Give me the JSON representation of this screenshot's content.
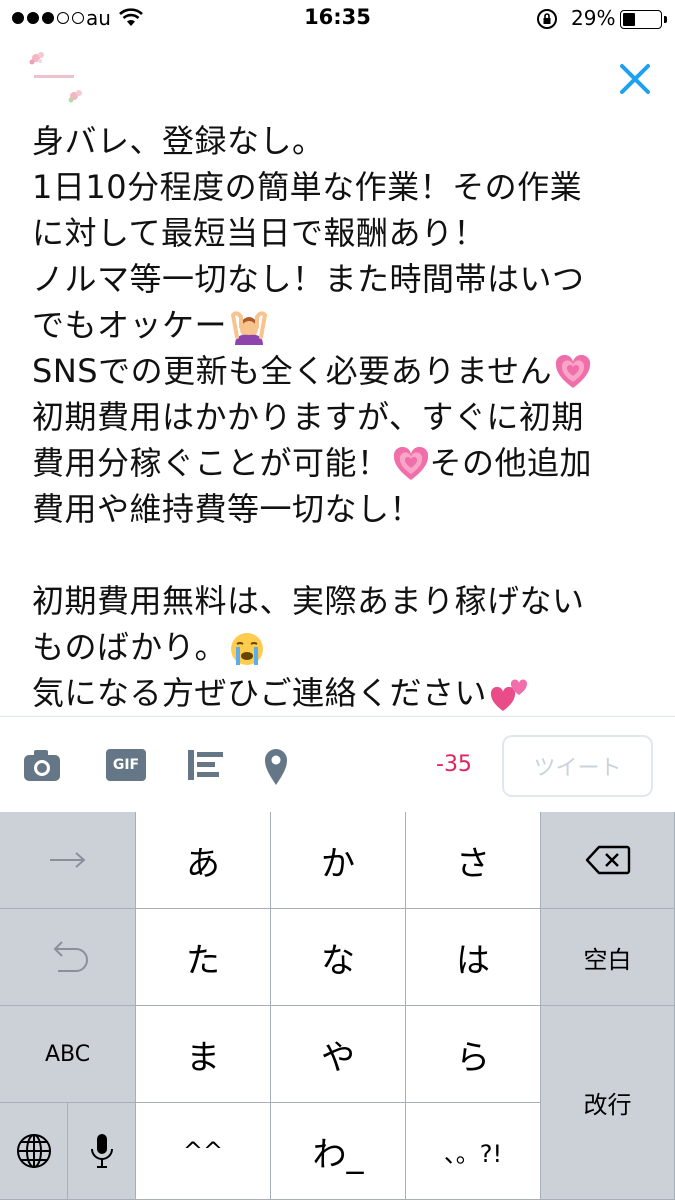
{
  "status_bar": {
    "carrier": "au",
    "time": "16:35",
    "battery_percent_text": "29%",
    "battery_level": 0.29,
    "signal_bars_filled": 3,
    "signal_bars_total": 5
  },
  "compose": {
    "lines": [
      "身バレ、登録なし。",
      "1日10分程度の簡単な作業！その作業",
      "に対して最短当日で報酬あり！",
      "ノルマ等一切なし！また時間帯はいつ",
      "でもオッケー",
      "SNSでの更新も全く必要ありません",
      "初期費用はかかりますが、すぐに初期",
      "費用分稼ぐことが可能！",
      "その他追加",
      "費用や維持費等一切なし！",
      "",
      "初期費用無料は、実際あまり稼げない",
      "ものばかり。",
      "気になる方ぜひご連絡ください"
    ],
    "emojis": [
      "ok-gesture-emoji",
      "growing-heart-emoji",
      "growing-heart-emoji",
      "crying-face-emoji",
      "two-hearts-emoji"
    ]
  },
  "toolbar": {
    "gif_label": "GIF",
    "char_counter": "-35",
    "tweet_label": "ツイート"
  },
  "keyboard": {
    "row1": [
      "あ",
      "か",
      "さ"
    ],
    "row2": [
      "た",
      "な",
      "は"
    ],
    "row3": [
      "ま",
      "や",
      "ら"
    ],
    "row4": [
      "^^",
      "わ_",
      "、。?!"
    ],
    "abc_label": "ABC",
    "space_label": "空白",
    "return_label": "改行"
  },
  "colors": {
    "twitter_blue": "#1da1f2",
    "counter_red": "#e0245e",
    "heart_pink": "#f06eaa"
  }
}
